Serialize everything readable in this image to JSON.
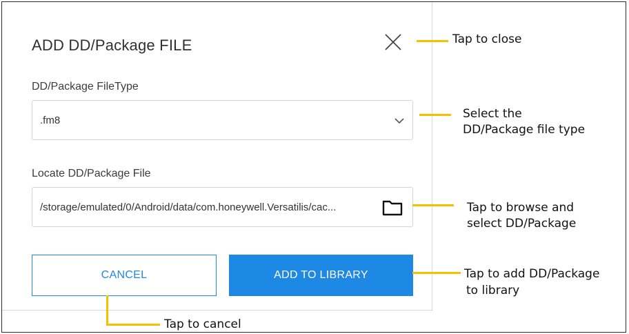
{
  "dialog": {
    "title": "ADD DD/Package FILE",
    "file_type_label": "DD/Package FileType",
    "file_type_value": ".fm8",
    "locate_label": "Locate DD/Package File",
    "locate_value": "/storage/emulated/0/Android/data/com.honeywell.Versatilis/cac...",
    "cancel_label": "CANCEL",
    "add_label": "ADD TO LIBRARY"
  },
  "icons": {
    "close": "close-icon",
    "dropdown": "chevron-down-icon",
    "browse": "folder-icon"
  },
  "callouts": {
    "close": "Tap to close",
    "select_line1": "Select the",
    "select_line2": "DD/Package file type",
    "browse_line1": "Tap to browse and",
    "browse_line2": "select DD/Package",
    "add_line1": "Tap to add DD/Package",
    "add_line2": "to library",
    "cancel": "Tap to cancel"
  },
  "colors": {
    "accent": "#1e88e5",
    "callout_line": "#f2c200"
  }
}
